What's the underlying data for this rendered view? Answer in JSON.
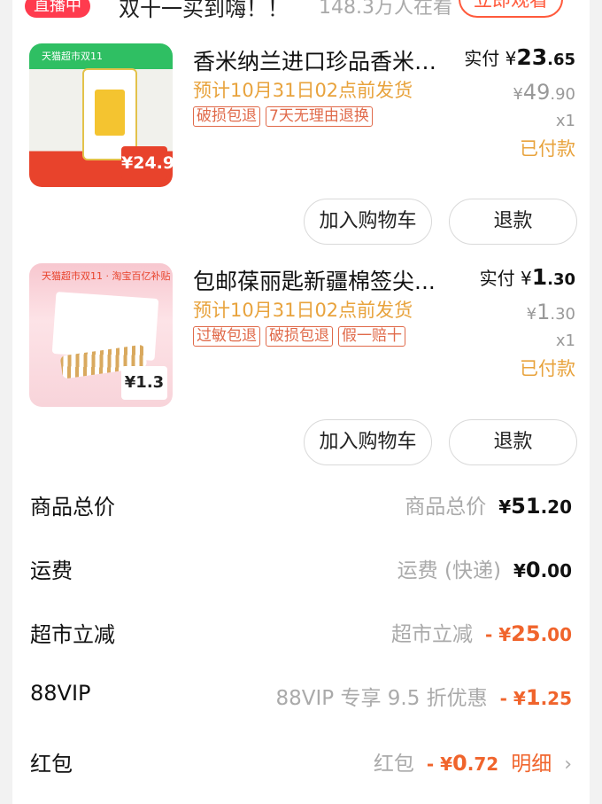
{
  "live": {
    "badge": "直播中",
    "title": "双十一买到嗨！！",
    "viewers": "148.3万人在看",
    "watch_button": "立即观看"
  },
  "items": [
    {
      "thumb_tag": "天猫超市双11",
      "thumb_price": "¥24.9",
      "title": "香米纳兰进口珍品香米2....",
      "ship": "预计10月31日02点前发货",
      "tags": [
        "破损包退",
        "7天无理由退换"
      ],
      "paid_label": "实付",
      "paid_currency": "¥",
      "paid_int": "23",
      "paid_dec": ".65",
      "orig_currency": "¥",
      "orig_int": "49",
      "orig_dec": ".90",
      "qty": "x1",
      "status": "已付款",
      "cart_button": "加入购物车",
      "refund_button": "退款"
    },
    {
      "thumb_tag": "天猫超市双11 · 淘宝百亿补贴",
      "thumb_price": "¥1.3",
      "title": "包邮葆丽匙新疆棉签尖...",
      "ship": "预计10月31日02点前发货",
      "tags": [
        "过敏包退",
        "破损包退",
        "假一赔十"
      ],
      "paid_label": "实付",
      "paid_currency": "¥",
      "paid_int": "1",
      "paid_dec": ".30",
      "orig_currency": "¥",
      "orig_int": "1",
      "orig_dec": ".30",
      "qty": "x1",
      "status": "已付款",
      "cart_button": "加入购物车",
      "refund_button": "退款"
    }
  ],
  "summary": [
    {
      "label": "商品总价",
      "sub": "商品总价",
      "prefix": "¥",
      "int": "51",
      "dec": ".20",
      "negative": false
    },
    {
      "label": "运费",
      "sub": "运费 (快递)",
      "prefix": "¥",
      "int": "0",
      "dec": ".00",
      "negative": false
    },
    {
      "label": "超市立减",
      "sub": "超市立减",
      "prefix": "- ¥",
      "int": "25",
      "dec": ".00",
      "negative": true
    },
    {
      "label": "88VIP",
      "sub": "88VIP 专享 9.5 折优惠",
      "prefix": "- ¥",
      "int": "1",
      "dec": ".25",
      "negative": true
    },
    {
      "label": "红包",
      "sub": "红包",
      "prefix": "- ¥",
      "int": "0",
      "dec": ".72",
      "negative": true,
      "detail": "明细"
    }
  ]
}
